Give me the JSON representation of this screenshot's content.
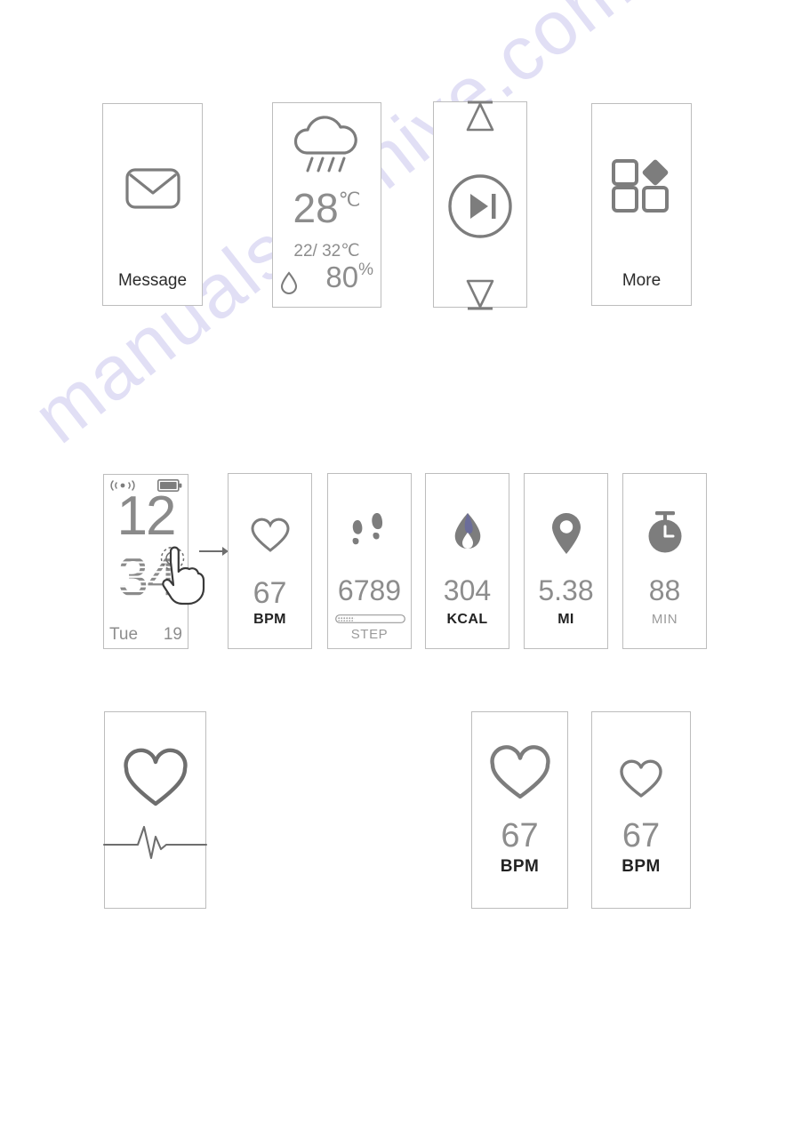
{
  "watermark": {
    "text": "manualsarchive.com",
    "color": "#c9c6ee"
  },
  "theme": {
    "line": "#bdbdbd",
    "icon_grey": "#7d7d7d",
    "value_grey": "#8d8d8d",
    "text_dark": "#222222"
  },
  "row1": {
    "message": {
      "label": "Message",
      "icon": "envelope-icon"
    },
    "weather": {
      "icon": "rain-cloud-icon",
      "temperature": "28",
      "temperature_unit": "℃",
      "range": "22/ 32℃",
      "humidity_icon": "water-drop-icon",
      "humidity": "80",
      "humidity_unit": "%"
    },
    "music": {
      "volume_up_icon": "volume-up-triangle-icon",
      "play_pause_icon": "play-pause-icon",
      "volume_down_icon": "volume-down-triangle-icon"
    },
    "more": {
      "label": "More",
      "icon": "grid-apps-icon"
    }
  },
  "row2": {
    "clock": {
      "signal_icon": "signal-waves-icon",
      "battery_icon": "battery-full-icon",
      "hour": "12",
      "minute": "34",
      "weekday": "Tue",
      "day": "19",
      "gesture_icon": "tap-hand-icon"
    },
    "arrow_icon": "arrow-right-icon",
    "metrics": [
      {
        "icon": "heart-outline-icon",
        "value": "67",
        "unit": "BPM",
        "unit_style": "dark"
      },
      {
        "icon": "footsteps-icon",
        "value": "6789",
        "unit": "STEP",
        "unit_style": "grey",
        "progress": 26
      },
      {
        "icon": "flame-icon",
        "value": "304",
        "unit": "KCAL",
        "unit_style": "dark"
      },
      {
        "icon": "location-pin-icon",
        "value": "5.38",
        "unit": "MI",
        "unit_style": "dark"
      },
      {
        "icon": "stopwatch-icon",
        "value": "88",
        "unit": "MIN",
        "unit_style": "grey"
      }
    ]
  },
  "row3": {
    "ecg": {
      "heart_icon": "heart-outline-icon",
      "pulse_icon": "ecg-pulse-line-icon"
    },
    "bpm_large": {
      "icon": "heart-outline-icon",
      "value": "67",
      "unit": "BPM"
    },
    "bpm_small": {
      "icon": "heart-outline-icon",
      "value": "67",
      "unit": "BPM"
    }
  }
}
